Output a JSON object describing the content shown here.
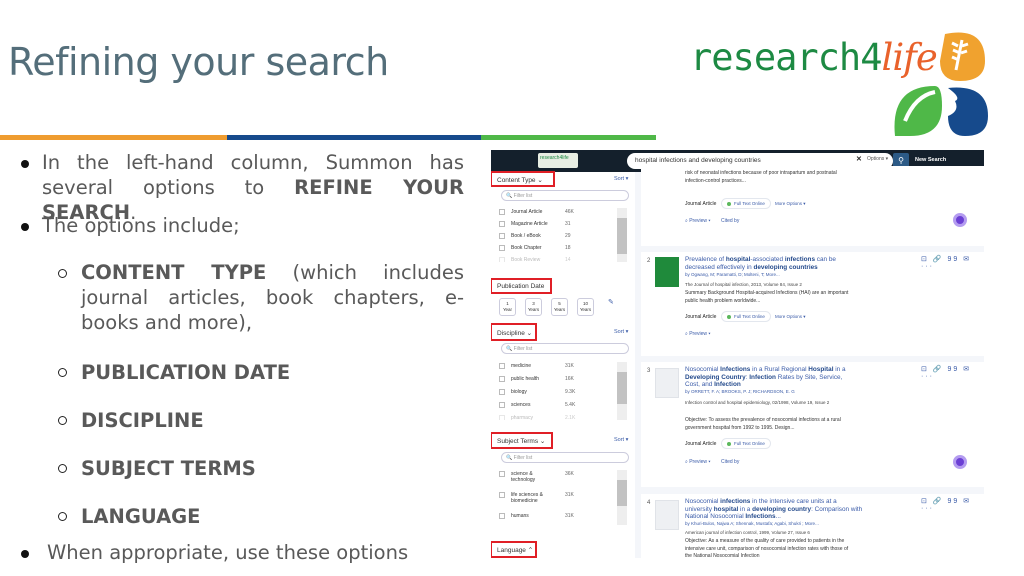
{
  "slide": {
    "title": "Refining your search",
    "colors": {
      "title": "#546e7a",
      "orange": "#ef9c2f",
      "blue": "#164a8c",
      "green": "#4fb848",
      "highlight": "#e01f26"
    }
  },
  "logo": {
    "text_main": "research4",
    "text_accent": "life",
    "mark": "leaf-wheat-drop-logo"
  },
  "bullets": {
    "b1_plain": "In the left-hand column, Summon has several options to ",
    "b1_bold": "REFINE YOUR SEARCH",
    "b1_end": ".",
    "b2": "The options include;",
    "sub1_bold": "CONTENT TYPE",
    "sub1_rest": " (which includes journal articles, book chapters, e-books and more),",
    "sub2": "PUBLICATION DATE",
    "sub3": "DISCIPLINE",
    "sub4": "SUBJECT TERMS",
    "sub5": "LANGUAGE",
    "b3": "When appropriate, use these options"
  },
  "screenshot": {
    "topbar": {
      "logo": "research4life",
      "search_value": "hospital infections and developing countries",
      "options_label": "Options ▾",
      "new_search": "New Search"
    },
    "facets": {
      "sort_label": "Sort ▾",
      "filter_placeholder": "Filter list",
      "content_type": {
        "label": "Content Type ⌄",
        "items": [
          {
            "name": "Journal Article",
            "count": "46K"
          },
          {
            "name": "Magazine Article",
            "count": "31"
          },
          {
            "name": "Book / eBook",
            "count": "29"
          },
          {
            "name": "Book Chapter",
            "count": "18"
          },
          {
            "name": "Book Review",
            "count": "14"
          }
        ]
      },
      "publication_date": {
        "label": "Publication Date",
        "buttons": [
          {
            "n": "1",
            "unit": "Year"
          },
          {
            "n": "3",
            "unit": "Years"
          },
          {
            "n": "5",
            "unit": "Years"
          },
          {
            "n": "10",
            "unit": "Years"
          }
        ]
      },
      "discipline": {
        "label": "Discipline ⌄",
        "items": [
          {
            "name": "medicine",
            "count": "31K"
          },
          {
            "name": "public health",
            "count": "16K"
          },
          {
            "name": "biology",
            "count": "9.3K"
          },
          {
            "name": "sciences",
            "count": "5.4K"
          },
          {
            "name": "pharmacy",
            "count": "2.1K"
          }
        ]
      },
      "subject_terms": {
        "label": "Subject Terms ⌄",
        "items": [
          {
            "name": "science & technology",
            "count": "36K"
          },
          {
            "name": "life sciences & biomedicine",
            "count": "31K"
          },
          {
            "name": "humans",
            "count": "31K"
          }
        ]
      },
      "language": {
        "label": "Language ⌃"
      }
    },
    "results": {
      "r1": {
        "snippet": "risk of neonatal infections because of poor intrapartum and postnatal infection-control practices...",
        "type": "Journal Article",
        "fulltext": "Full Text Online",
        "more": "More Options ▾",
        "preview": "Preview ▾",
        "cited": "Cited by"
      },
      "r2": {
        "num": "2",
        "title_html": "Prevalence of <b>hospital</b>-associated <b>infections</b> can be decreased effectively in <b>developing countries</b>",
        "authors": "by Ogwang, M; Paramatti, D; Molteni, T; More...",
        "source": "The Journal of hospital infection, 2013, Volume 84, Issue 2",
        "snippet": "Summary Background Hospital-acquired Infections (HAI) are an important public health problem worldwide...",
        "type": "Journal Article",
        "fulltext": "Full Text Online",
        "more": "More Options ▾",
        "preview": "Preview ▾"
      },
      "r3": {
        "num": "3",
        "title_html": "Nosocomial <b>Infections</b> in a Rural Regional <b>Hospital</b> in a <b>Developing Country</b>: <b>Infection</b> Rates by Site, Service, Cost, and <b>Infection</b>",
        "authors": "by ORRETT, F. A; BROOKS, P. J; RICHARDSON, E. G",
        "source": "Infection control and hospital epidemiology, 02/1998, Volume 19, Issue 2",
        "snippet": "Objective: To assess the prevalence of nosocomial infections at a rural government hospital from 1992 to 1995. Design...",
        "type": "Journal Article",
        "fulltext": "Full Text Online",
        "preview": "Preview ▾",
        "cited": "Cited by"
      },
      "r4": {
        "num": "4",
        "title_html": "Nosocomial <b>infections</b> in the intensive care units at a university <b>hospital</b> in a <b>developing country</b>: Comparison with National Nosocomial <b>Infections</b>...",
        "authors": "by Khuri-Bulos, Najwa A; Shennak, Mustafa; Agabi, Shukri ; More...",
        "source": "American journal of infection control, 1999, Volume 27, Issue 6",
        "snippet": "Objective: As a measure of the quality of care provided to patients in the intensive care unit, comparison of nosocomial infection rates with those of the National Nosocomial Infection"
      },
      "actions": "⊡ 🔗 99 ✉ ···"
    }
  }
}
